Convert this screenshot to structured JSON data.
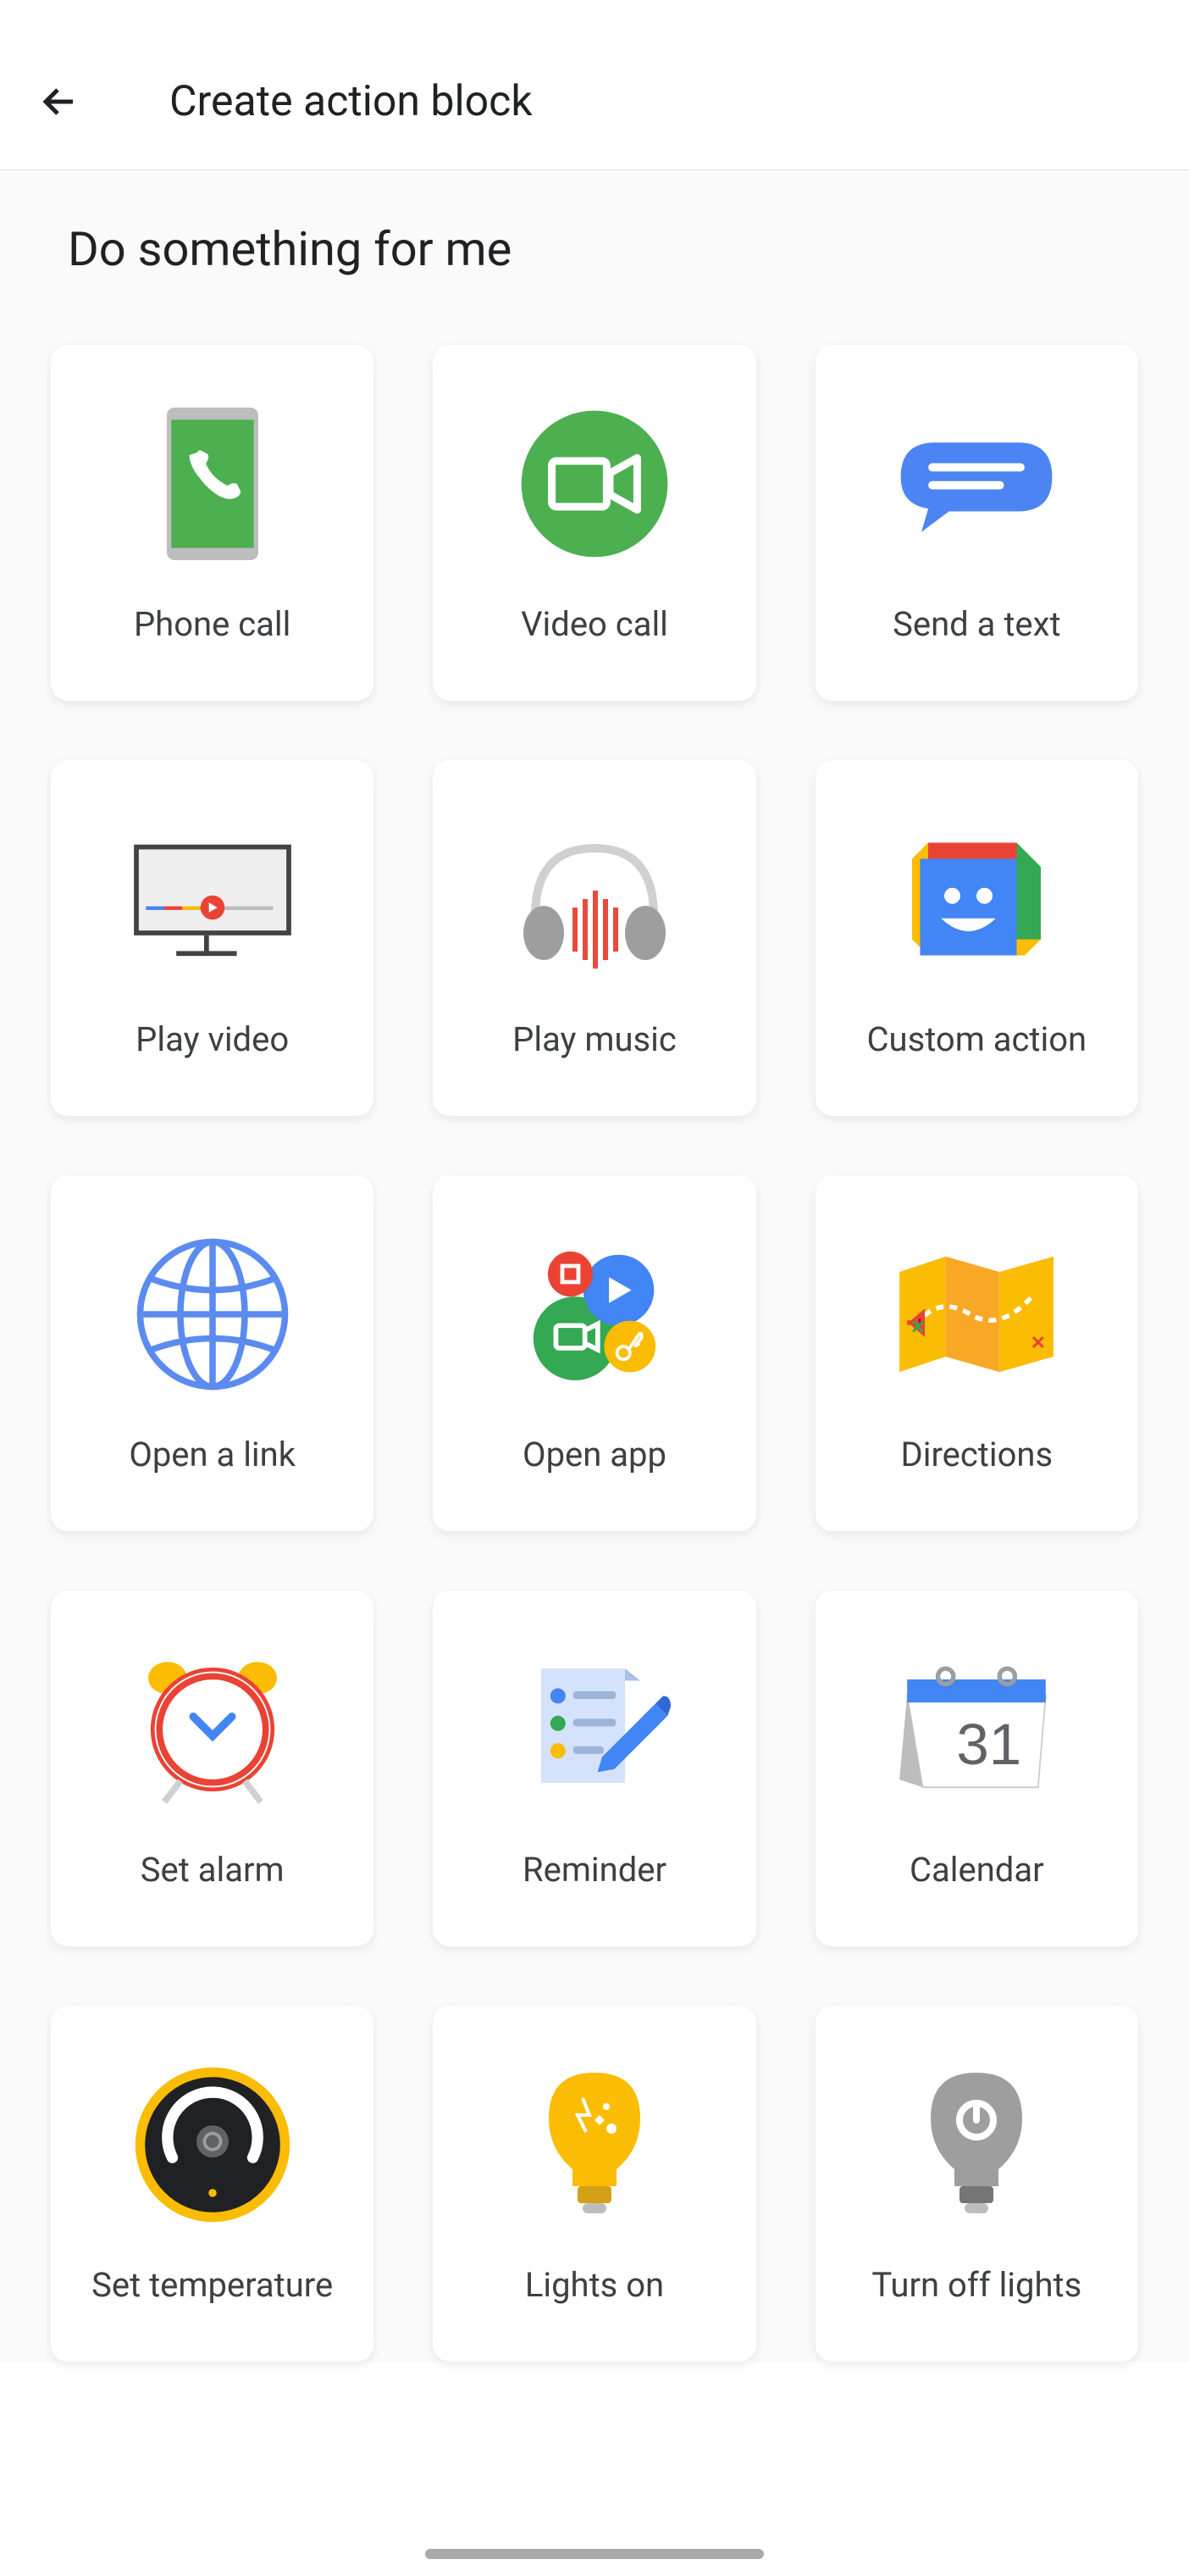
{
  "header": {
    "title": "Create action block"
  },
  "section": {
    "title": "Do something for me"
  },
  "cards": [
    {
      "label": "Phone call"
    },
    {
      "label": "Video call"
    },
    {
      "label": "Send a text"
    },
    {
      "label": "Play video"
    },
    {
      "label": "Play music"
    },
    {
      "label": "Custom action"
    },
    {
      "label": "Open a link"
    },
    {
      "label": "Open app"
    },
    {
      "label": "Directions"
    },
    {
      "label": "Set alarm"
    },
    {
      "label": "Reminder"
    },
    {
      "label": "Calendar"
    },
    {
      "label": "Set temperature"
    },
    {
      "label": "Lights on"
    },
    {
      "label": "Turn off lights"
    }
  ]
}
